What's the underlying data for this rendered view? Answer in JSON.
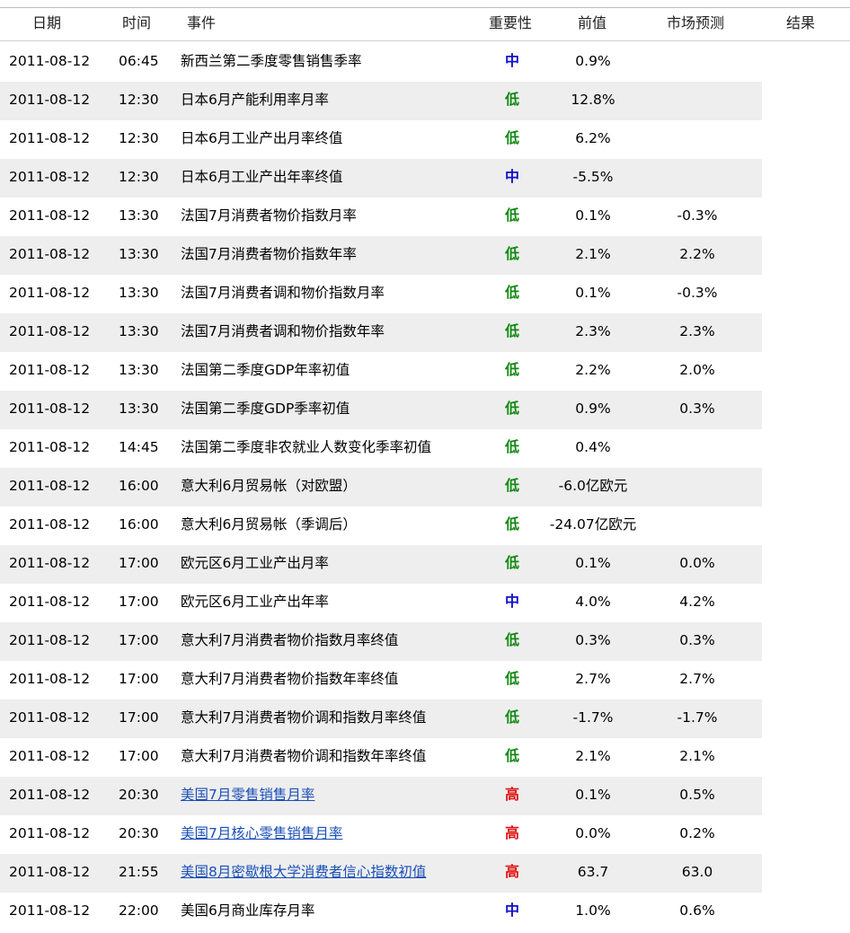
{
  "header": {
    "date": "日期",
    "time": "时间",
    "event": "事件",
    "importance": "重要性",
    "previous": "前值",
    "forecast": "市场预测",
    "result": "结果"
  },
  "colors": {
    "importance_mid": "#1010c8",
    "importance_low": "#128a12",
    "importance_high": "#e01010",
    "link": "#1a4fb8",
    "row_alt": "#eeeeee"
  },
  "rows": [
    {
      "date": "2011-08-12",
      "time": "06:45",
      "event": "新西兰第二季度零售销售季率",
      "importance": "中",
      "level": "mid",
      "previous": "0.9%",
      "forecast": "",
      "link": false
    },
    {
      "date": "2011-08-12",
      "time": "12:30",
      "event": "日本6月产能利用率月率",
      "importance": "低",
      "level": "low",
      "previous": "12.8%",
      "forecast": "",
      "link": false
    },
    {
      "date": "2011-08-12",
      "time": "12:30",
      "event": "日本6月工业产出月率终值",
      "importance": "低",
      "level": "low",
      "previous": "6.2%",
      "forecast": "",
      "link": false
    },
    {
      "date": "2011-08-12",
      "time": "12:30",
      "event": "日本6月工业产出年率终值",
      "importance": "中",
      "level": "mid",
      "previous": "-5.5%",
      "forecast": "",
      "link": false
    },
    {
      "date": "2011-08-12",
      "time": "13:30",
      "event": "法国7月消费者物价指数月率",
      "importance": "低",
      "level": "low",
      "previous": "0.1%",
      "forecast": "-0.3%",
      "link": false
    },
    {
      "date": "2011-08-12",
      "time": "13:30",
      "event": "法国7月消费者物价指数年率",
      "importance": "低",
      "level": "low",
      "previous": "2.1%",
      "forecast": "2.2%",
      "link": false
    },
    {
      "date": "2011-08-12",
      "time": "13:30",
      "event": "法国7月消费者调和物价指数月率",
      "importance": "低",
      "level": "low",
      "previous": "0.1%",
      "forecast": "-0.3%",
      "link": false
    },
    {
      "date": "2011-08-12",
      "time": "13:30",
      "event": "法国7月消费者调和物价指数年率",
      "importance": "低",
      "level": "low",
      "previous": "2.3%",
      "forecast": "2.3%",
      "link": false
    },
    {
      "date": "2011-08-12",
      "time": "13:30",
      "event": "法国第二季度GDP年率初值",
      "importance": "低",
      "level": "low",
      "previous": "2.2%",
      "forecast": "2.0%",
      "link": false
    },
    {
      "date": "2011-08-12",
      "time": "13:30",
      "event": "法国第二季度GDP季率初值",
      "importance": "低",
      "level": "low",
      "previous": "0.9%",
      "forecast": "0.3%",
      "link": false
    },
    {
      "date": "2011-08-12",
      "time": "14:45",
      "event": "法国第二季度非农就业人数变化季率初值",
      "importance": "低",
      "level": "low",
      "previous": "0.4%",
      "forecast": "",
      "link": false
    },
    {
      "date": "2011-08-12",
      "time": "16:00",
      "event": "意大利6月贸易帐（对欧盟）",
      "importance": "低",
      "level": "low",
      "previous": "-6.0亿欧元",
      "forecast": "",
      "link": false
    },
    {
      "date": "2011-08-12",
      "time": "16:00",
      "event": "意大利6月贸易帐（季调后）",
      "importance": "低",
      "level": "low",
      "previous": "-24.07亿欧元",
      "forecast": "",
      "link": false
    },
    {
      "date": "2011-08-12",
      "time": "17:00",
      "event": "欧元区6月工业产出月率",
      "importance": "低",
      "level": "low",
      "previous": "0.1%",
      "forecast": "0.0%",
      "link": false
    },
    {
      "date": "2011-08-12",
      "time": "17:00",
      "event": "欧元区6月工业产出年率",
      "importance": "中",
      "level": "mid",
      "previous": "4.0%",
      "forecast": "4.2%",
      "link": false
    },
    {
      "date": "2011-08-12",
      "time": "17:00",
      "event": "意大利7月消费者物价指数月率终值",
      "importance": "低",
      "level": "low",
      "previous": "0.3%",
      "forecast": "0.3%",
      "link": false
    },
    {
      "date": "2011-08-12",
      "time": "17:00",
      "event": "意大利7月消费者物价指数年率终值",
      "importance": "低",
      "level": "low",
      "previous": "2.7%",
      "forecast": "2.7%",
      "link": false
    },
    {
      "date": "2011-08-12",
      "time": "17:00",
      "event": "意大利7月消费者物价调和指数月率终值",
      "importance": "低",
      "level": "low",
      "previous": "-1.7%",
      "forecast": "-1.7%",
      "link": false
    },
    {
      "date": "2011-08-12",
      "time": "17:00",
      "event": "意大利7月消费者物价调和指数年率终值",
      "importance": "低",
      "level": "low",
      "previous": "2.1%",
      "forecast": "2.1%",
      "link": false
    },
    {
      "date": "2011-08-12",
      "time": "20:30",
      "event": "美国7月零售销售月率",
      "importance": "高",
      "level": "high",
      "previous": "0.1%",
      "forecast": "0.5%",
      "link": true
    },
    {
      "date": "2011-08-12",
      "time": "20:30",
      "event": "美国7月核心零售销售月率",
      "importance": "高",
      "level": "high",
      "previous": "0.0%",
      "forecast": "0.2%",
      "link": true
    },
    {
      "date": "2011-08-12",
      "time": "21:55",
      "event": "美国8月密歇根大学消费者信心指数初值",
      "importance": "高",
      "level": "high",
      "previous": "63.7",
      "forecast": "63.0",
      "link": true
    },
    {
      "date": "2011-08-12",
      "time": "22:00",
      "event": "美国6月商业库存月率",
      "importance": "中",
      "level": "mid",
      "previous": "1.0%",
      "forecast": "0.6%",
      "link": false
    }
  ]
}
